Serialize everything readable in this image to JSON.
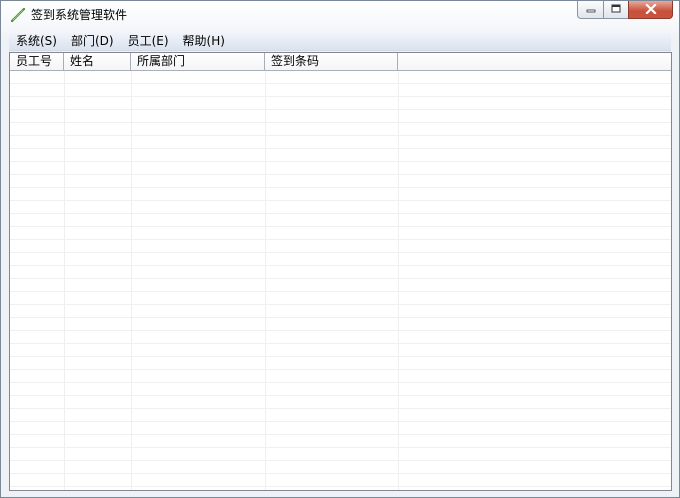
{
  "window": {
    "title": "签到系统管理软件",
    "icon": "pen-icon"
  },
  "menu": {
    "items": [
      {
        "label": "系统(S)"
      },
      {
        "label": "部门(D)"
      },
      {
        "label": "员工(E)"
      },
      {
        "label": "帮助(H)"
      }
    ]
  },
  "table": {
    "columns": [
      {
        "label": "员工号"
      },
      {
        "label": "姓名"
      },
      {
        "label": "所属部门"
      },
      {
        "label": "签到条码"
      },
      {
        "label": ""
      }
    ],
    "rows": []
  },
  "colors": {
    "close_button": "#c7503a",
    "menubar": "#dbe3ee",
    "grid_line": "#f0f0f0"
  }
}
